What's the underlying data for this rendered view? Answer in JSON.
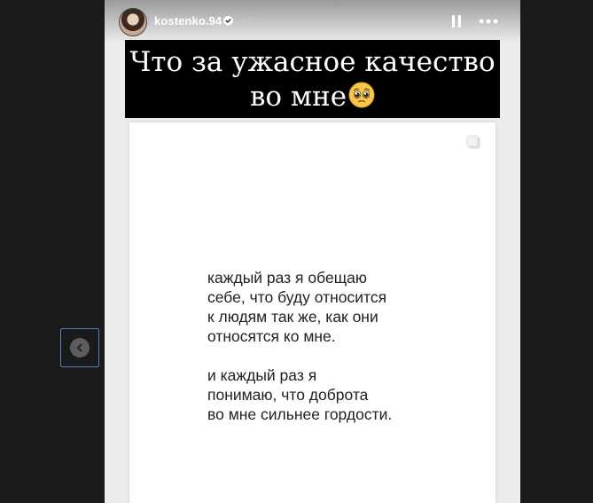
{
  "story": {
    "username": "kostenko.94",
    "time_ago": "17 ч.",
    "caption_line1": "Что за ужасное качество",
    "caption_line2": "во мне",
    "caption_emoji": "pleading-face-emoji",
    "quote_paragraph1": "каждый раз я обещаю\nсебе, что буду относится\nк людям так же, как они\nотносятся ко мне.",
    "quote_paragraph2": "и каждый раз я\nпонимаю, что доброта\nво мне сильнее гордости."
  },
  "icons": {
    "verified": "verified-badge-icon",
    "pause": "pause-icon",
    "more": "more-options-icon",
    "copy": "copy-icon",
    "prev": "chevron-left-icon"
  },
  "colors": {
    "page_background": "#1a1a1a",
    "caption_background": "#000000",
    "verified_badge": "#ffffff",
    "nav_focus_border": "#5b7fbf"
  }
}
